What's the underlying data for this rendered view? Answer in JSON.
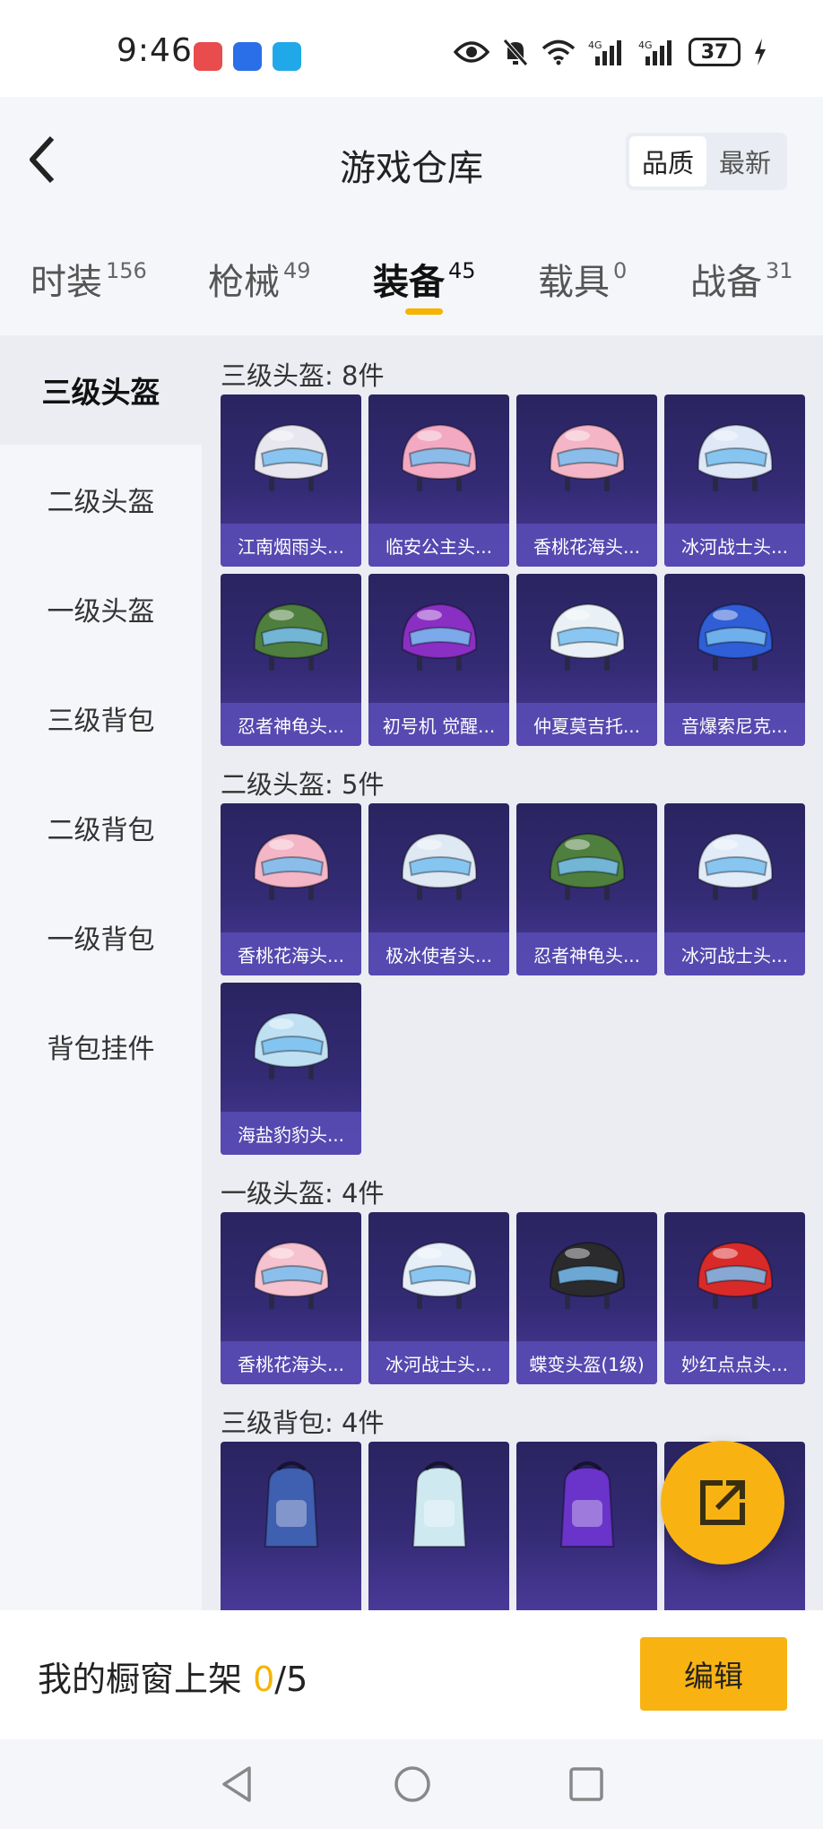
{
  "status_bar": {
    "time": "9:46",
    "battery": "37",
    "app_colors": [
      "#e84c4c",
      "#2a6ee8",
      "#20a8e8"
    ]
  },
  "header": {
    "title": "游戏仓库",
    "sort_quality": "品质",
    "sort_newest": "最新"
  },
  "tabs": [
    {
      "label": "时装",
      "count": "156"
    },
    {
      "label": "枪械",
      "count": "49"
    },
    {
      "label": "装备",
      "count": "45"
    },
    {
      "label": "载具",
      "count": "0"
    },
    {
      "label": "战备",
      "count": "31"
    }
  ],
  "sidebar": [
    {
      "label": "三级头盔"
    },
    {
      "label": "二级头盔"
    },
    {
      "label": "一级头盔"
    },
    {
      "label": "三级背包"
    },
    {
      "label": "二级背包"
    },
    {
      "label": "一级背包"
    },
    {
      "label": "背包挂件"
    }
  ],
  "sections": [
    {
      "title": "三级头盔: 8件",
      "items": [
        {
          "name": "江南烟雨头...",
          "icon": "helmet-icon",
          "color": "#e8e6ef"
        },
        {
          "name": "临安公主头...",
          "icon": "helmet-icon",
          "color": "#f2a9c1"
        },
        {
          "name": "香桃花海头...",
          "icon": "helmet-icon",
          "color": "#f4b6c6"
        },
        {
          "name": "冰河战士头...",
          "icon": "helmet-icon",
          "color": "#dfe8f6"
        },
        {
          "name": "忍者神龟头...",
          "icon": "helmet-icon",
          "color": "#4f7f3e"
        },
        {
          "name": "初号机 觉醒...",
          "icon": "helmet-icon",
          "color": "#8a2fc3"
        },
        {
          "name": "仲夏莫吉托...",
          "icon": "helmet-icon",
          "color": "#e9f1f6"
        },
        {
          "name": "音爆索尼克...",
          "icon": "helmet-icon",
          "color": "#2f5ed6"
        }
      ]
    },
    {
      "title": "二级头盔: 5件",
      "items": [
        {
          "name": "香桃花海头...",
          "icon": "helmet-icon",
          "color": "#f4b6c6"
        },
        {
          "name": "极冰使者头...",
          "icon": "helmet-icon",
          "color": "#dfe9f3"
        },
        {
          "name": "忍者神龟头...",
          "icon": "helmet-icon",
          "color": "#4f7f3e"
        },
        {
          "name": "冰河战士头...",
          "icon": "helmet-icon",
          "color": "#e2ecf8"
        },
        {
          "name": "海盐豹豹头...",
          "icon": "helmet-icon",
          "color": "#bfe0f2"
        }
      ]
    },
    {
      "title": "一级头盔: 4件",
      "items": [
        {
          "name": "香桃花海头...",
          "icon": "helmet-icon",
          "color": "#f6c2cf"
        },
        {
          "name": "冰河战士头...",
          "icon": "helmet-icon",
          "color": "#e6eef8"
        },
        {
          "name": "蝶变头盔(1级)",
          "icon": "helmet-icon",
          "color": "#2b2b2e"
        },
        {
          "name": "妙红点点头...",
          "icon": "helmet-icon",
          "color": "#d92a2a"
        }
      ]
    },
    {
      "title": "三级背包: 4件",
      "items": [
        {
          "name": "",
          "icon": "backpack-icon",
          "color": "#3f5fb0"
        },
        {
          "name": "",
          "icon": "backpack-icon",
          "color": "#cfe9f1"
        },
        {
          "name": "",
          "icon": "backpack-icon",
          "color": "#6a33c9"
        },
        {
          "name": "",
          "icon": "backpack-icon",
          "color": "#c72b3a"
        }
      ]
    }
  ],
  "showcase": {
    "label": "我的橱窗上架",
    "count": "0",
    "total": "/5",
    "edit_label": "编辑"
  },
  "colors": {
    "accent": "#f8b313",
    "card_caption": "#5b4eb9",
    "card_bg": "#2a2460"
  }
}
